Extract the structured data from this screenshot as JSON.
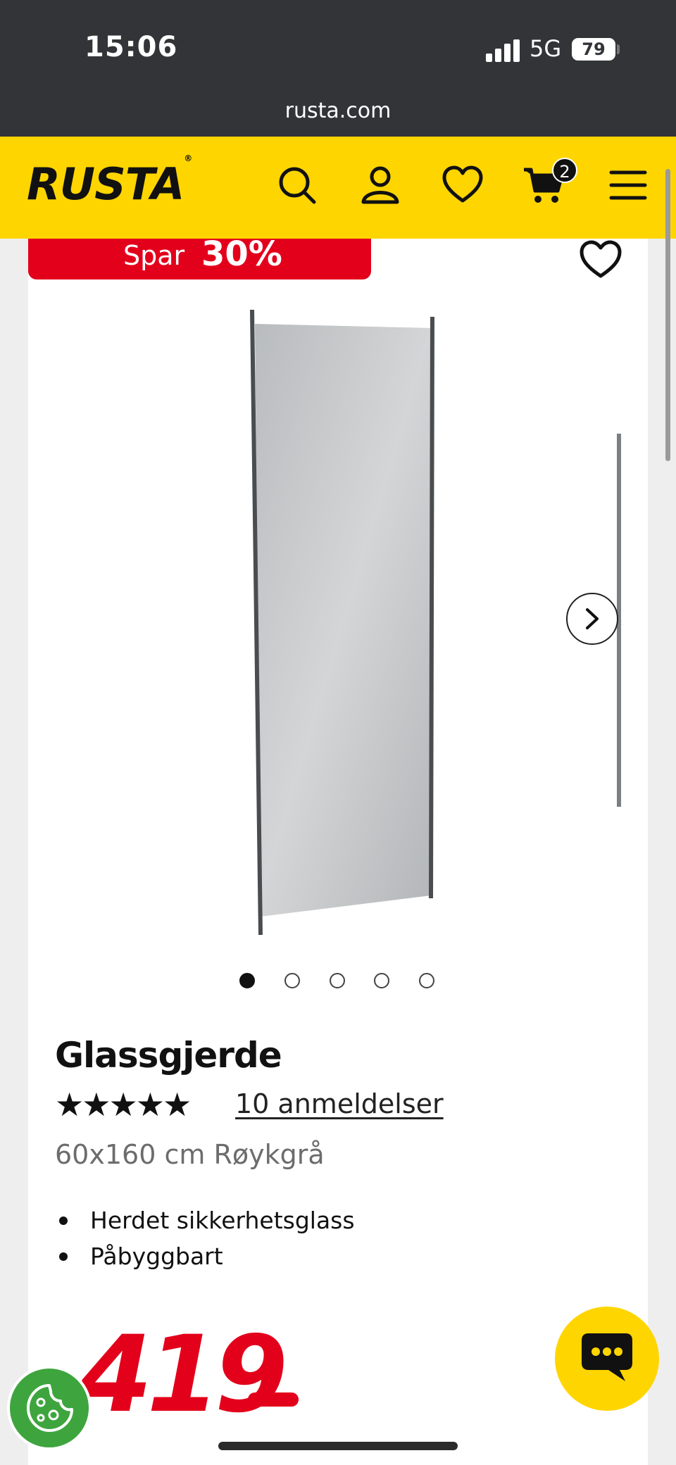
{
  "status_bar": {
    "time": "15:06",
    "network": "5G",
    "battery": "79"
  },
  "browser": {
    "url": "rusta.com"
  },
  "header": {
    "logo": "RUSTA",
    "logo_mark": "®",
    "cart_count": "2",
    "icons": [
      "search-icon",
      "account-icon",
      "heart-icon",
      "cart-icon",
      "menu-icon"
    ]
  },
  "product": {
    "badge_label": "Spar",
    "badge_value": "30%",
    "title": "Glassgjerde",
    "rating_stars": "★★★★★",
    "rating": 5,
    "reviews": "10 anmeldelser",
    "variant": "60x160 cm Røykgrå",
    "features": [
      "Herdet sikkerhetsglass",
      "Påbyggbart"
    ],
    "price": "419",
    "image_count": 5,
    "active_image": 1
  },
  "colors": {
    "brand_yellow": "#ffd500",
    "sale_red": "#e3001b",
    "status_dark": "#323437",
    "cookie_green": "#3ea53e"
  }
}
